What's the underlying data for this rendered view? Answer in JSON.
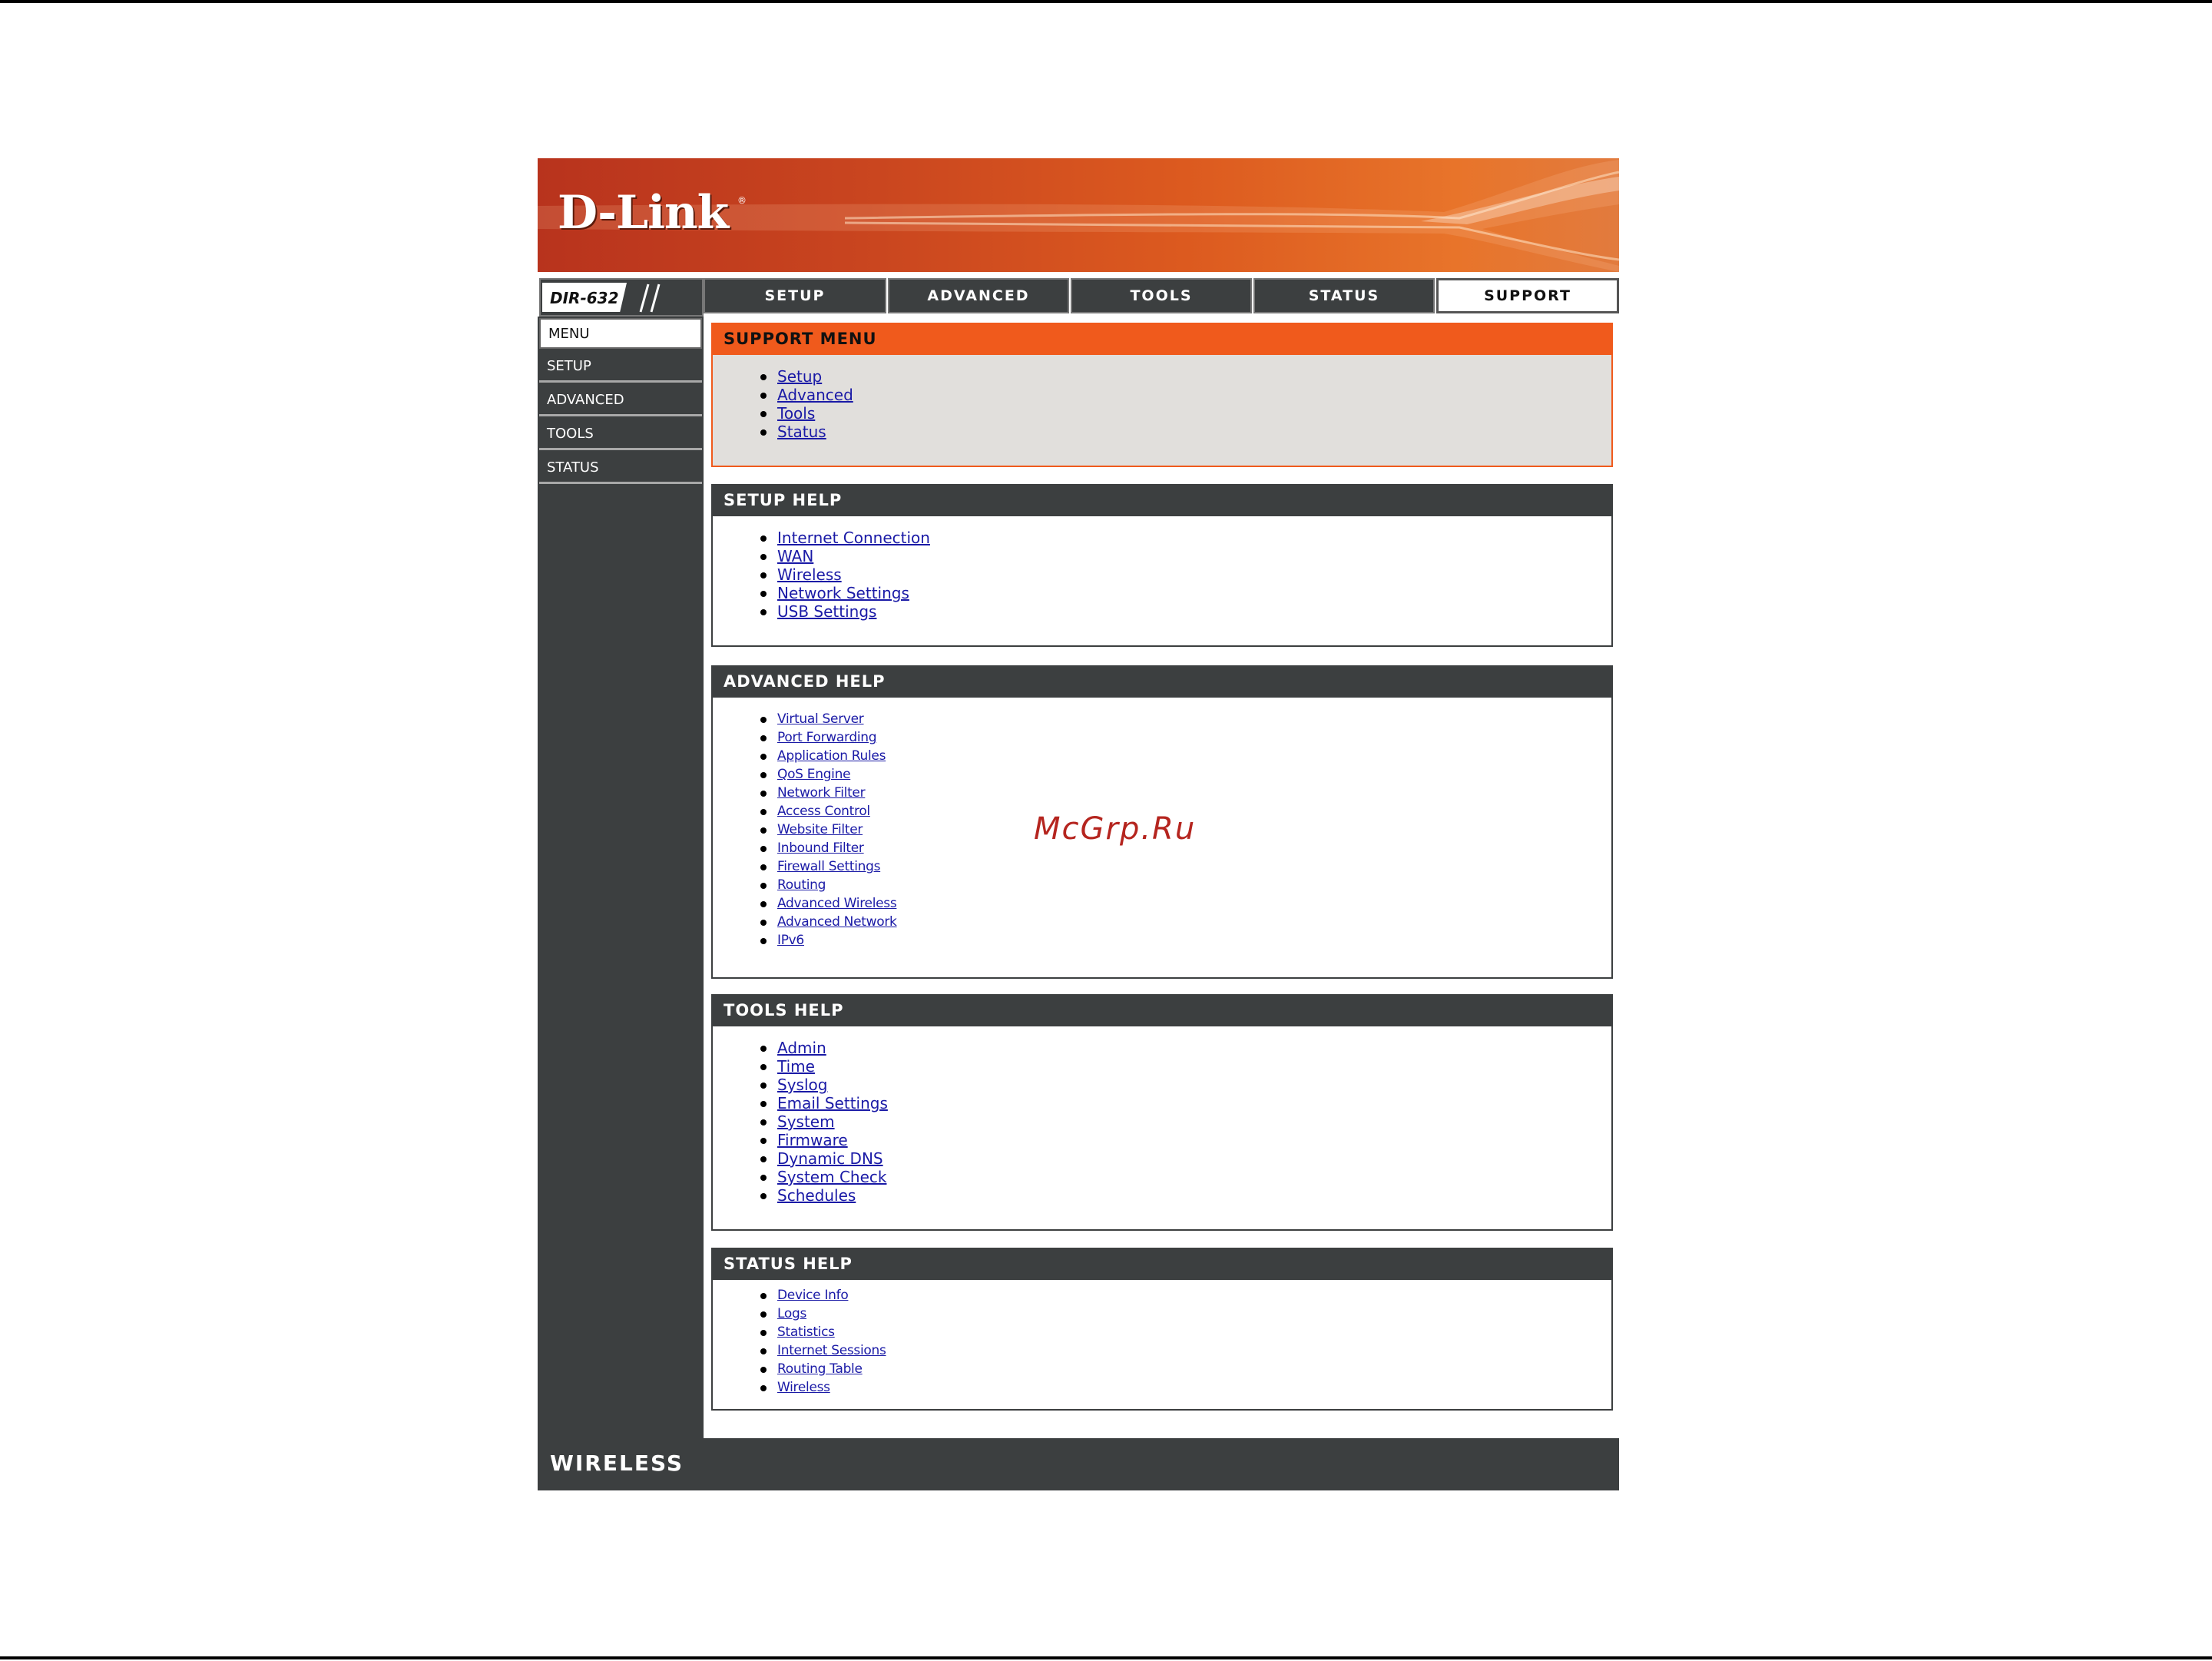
{
  "brand": {
    "logo_text": "D-Link",
    "registered_mark": "®",
    "model": "DIR-632",
    "footer_text": "WIRELESS"
  },
  "topnav": {
    "tabs": [
      {
        "label": "SETUP",
        "active": false
      },
      {
        "label": "ADVANCED",
        "active": false
      },
      {
        "label": "TOOLS",
        "active": false
      },
      {
        "label": "STATUS",
        "active": false
      },
      {
        "label": "SUPPORT",
        "active": true
      }
    ]
  },
  "sidebar": {
    "items": [
      {
        "label": "MENU",
        "active": true
      },
      {
        "label": "SETUP",
        "active": false
      },
      {
        "label": "ADVANCED",
        "active": false
      },
      {
        "label": "TOOLS",
        "active": false
      },
      {
        "label": "STATUS",
        "active": false
      }
    ]
  },
  "sections": {
    "support_menu": {
      "title": "SUPPORT MENU",
      "links": [
        "Setup",
        "Advanced",
        "Tools",
        "Status"
      ]
    },
    "setup_help": {
      "title": "SETUP HELP",
      "links": [
        "Internet Connection",
        "WAN",
        "Wireless",
        "Network Settings",
        "USB Settings"
      ]
    },
    "advanced_help": {
      "title": "ADVANCED HELP",
      "links": [
        "Virtual Server",
        "Port Forwarding",
        "Application Rules",
        "QoS Engine",
        "Network Filter",
        "Access Control",
        "Website Filter",
        "Inbound Filter",
        "Firewall Settings",
        "Routing",
        "Advanced Wireless",
        "Advanced Network",
        "IPv6"
      ]
    },
    "tools_help": {
      "title": "TOOLS HELP",
      "links": [
        "Admin",
        "Time",
        "Syslog",
        "Email Settings",
        "System",
        "Firmware",
        "Dynamic DNS",
        "System Check",
        "Schedules"
      ]
    },
    "status_help": {
      "title": "STATUS HELP",
      "links": [
        "Device Info",
        "Logs",
        "Statistics",
        "Internet Sessions",
        "Routing Table",
        "Wireless"
      ]
    }
  },
  "watermark": "McGrp.Ru",
  "colors": {
    "accent_orange": "#f05a1c",
    "nav_dark": "#3c3f40",
    "link_blue": "#1a1aa6",
    "support_body": "#e1dfdc"
  }
}
